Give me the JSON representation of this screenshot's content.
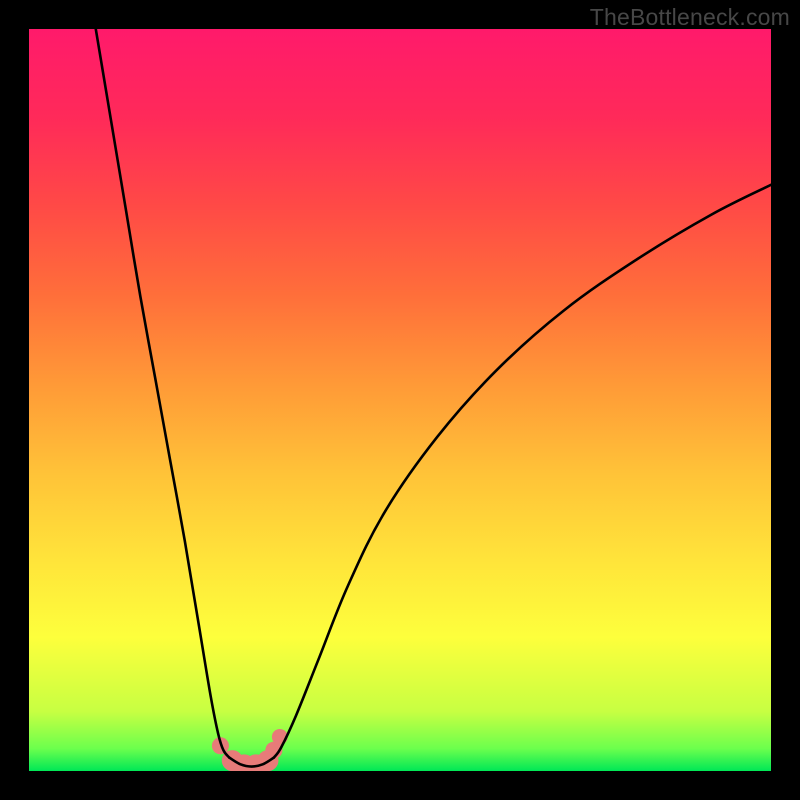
{
  "watermark": "TheBottleneck.com",
  "chart_data": {
    "type": "line",
    "title": "",
    "xlabel": "",
    "ylabel": "",
    "xlim": [
      0,
      100
    ],
    "ylim": [
      0,
      100
    ],
    "grid": false,
    "series": [
      {
        "name": "left-branch",
        "x": [
          9,
          11,
          13,
          15,
          17,
          19,
          21,
          23,
          24.5,
          25.5,
          26.2,
          27
        ],
        "y": [
          100,
          88,
          76,
          64,
          53,
          42,
          31,
          19,
          10,
          5,
          2.8,
          1.8
        ]
      },
      {
        "name": "right-branch",
        "x": [
          33,
          34,
          36,
          39,
          43,
          48,
          55,
          63,
          72,
          82,
          92,
          100
        ],
        "y": [
          1.8,
          3.2,
          7.5,
          15,
          25,
          35,
          45,
          54,
          62,
          69,
          75,
          79
        ]
      },
      {
        "name": "valley-floor",
        "x": [
          27,
          28.5,
          30,
          31.5,
          33
        ],
        "y": [
          1.8,
          0.9,
          0.6,
          0.9,
          1.8
        ]
      }
    ],
    "markers": {
      "name": "valley-markers",
      "color": "#e77b79",
      "points": [
        {
          "x": 25.8,
          "y": 3.4,
          "r": 3.4
        },
        {
          "x": 27.4,
          "y": 1.4,
          "r": 4.6
        },
        {
          "x": 29.0,
          "y": 0.7,
          "r": 5.2
        },
        {
          "x": 30.6,
          "y": 0.7,
          "r": 5.2
        },
        {
          "x": 32.2,
          "y": 1.4,
          "r": 4.6
        },
        {
          "x": 33.0,
          "y": 2.8,
          "r": 3.4
        },
        {
          "x": 33.8,
          "y": 4.6,
          "r": 3.0
        }
      ]
    },
    "colors": {
      "curve": "#000000",
      "marker": "#e77b79",
      "gradient_stops": [
        "#00e756",
        "#fdff3c",
        "#ff9a37",
        "#ff2a59",
        "#ff1a6b"
      ]
    }
  }
}
